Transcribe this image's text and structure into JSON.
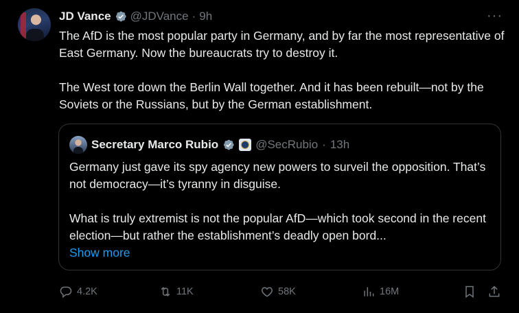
{
  "tweet": {
    "author_name": "JD Vance",
    "handle": "@JDVance",
    "separator": "·",
    "time": "9h",
    "more": "···",
    "text": "The AfD is the most popular party in Germany, and by far the most representative of East Germany. Now the bureaucrats try to destroy it.\n\nThe West tore down the Berlin Wall together. And it has been rebuilt—not by the Soviets or the Russians, but by the German establishment."
  },
  "quote": {
    "author_name": "Secretary Marco Rubio",
    "handle": "@SecRubio",
    "separator": "·",
    "time": "13h",
    "text": "Germany just gave its spy agency new powers to surveil the opposition. That’s not democracy—it’s tyranny in disguise.\n\nWhat is truly extremist is not the popular AfD—which took second in the recent election—but rather the establishment’s deadly open bord...",
    "show_more": "Show more"
  },
  "actions": {
    "replies": "4.2K",
    "reposts": "11K",
    "likes": "58K",
    "views": "16M"
  },
  "colors": {
    "background": "#000000",
    "text": "#e7e9ea",
    "muted": "#71767b",
    "accent": "#1d9bf0",
    "border": "#2f3336"
  },
  "icons": [
    "verified-badge-icon",
    "more-icon",
    "reply-icon",
    "repost-icon",
    "like-icon",
    "views-icon",
    "bookmark-icon",
    "share-icon",
    "government-seal-icon"
  ]
}
